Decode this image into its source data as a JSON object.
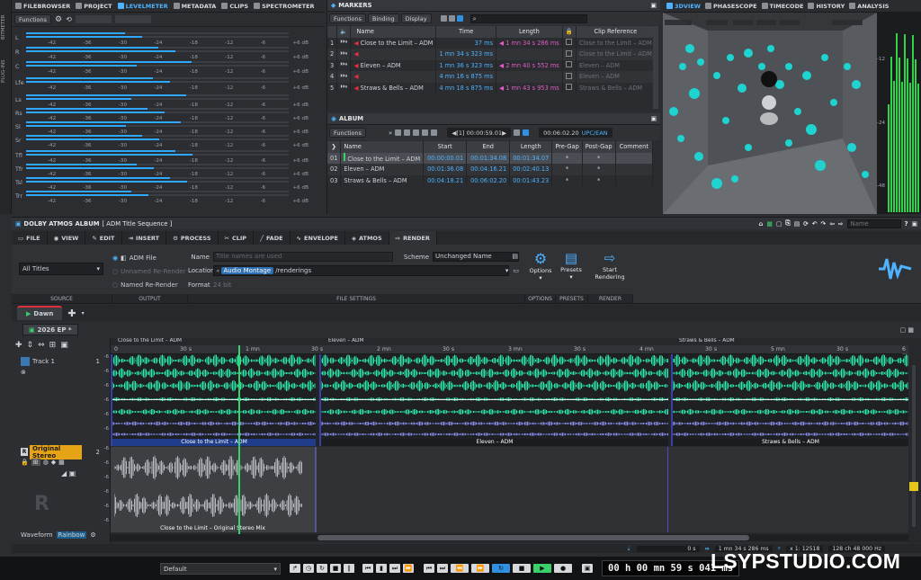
{
  "top_tabs": [
    {
      "label": "FILEBROWSER",
      "active": false
    },
    {
      "label": "PROJECT",
      "active": false
    },
    {
      "label": "LEVELMETER",
      "active": true
    },
    {
      "label": "METADATA",
      "active": false
    },
    {
      "label": "CLIPS",
      "active": false
    },
    {
      "label": "SPECTROMETER",
      "active": false
    }
  ],
  "side_strip": {
    "items": [
      "BITMETER",
      "PLUG-INS"
    ]
  },
  "levelmeter": {
    "functions_label": "Functions",
    "scale": [
      "-42",
      "-36",
      "-30",
      "-24",
      "-18",
      "-12",
      "-6",
      "+6 dB"
    ],
    "channels": [
      "L",
      "R",
      "C",
      "Lfe",
      "Ls",
      "Rs",
      "Sl",
      "Sr",
      "Tfl",
      "Tfr",
      "Tsl",
      "Trr"
    ]
  },
  "markers": {
    "title": "MARKERS",
    "toolbar": [
      "Functions",
      "Binding",
      "Display"
    ],
    "columns": [
      "Name",
      "Time",
      "Length",
      "Clip Reference"
    ],
    "rows": [
      {
        "num": "1",
        "name": "Close to the Limit – ADM",
        "time": "37 ms",
        "length": "1 mn 34 s 286 ms",
        "clip": "Close to the Limit – ADM"
      },
      {
        "num": "2",
        "name": "",
        "time": "1 mn 34 s 323 ms",
        "length": "",
        "clip": "Close to the Limit – ADM"
      },
      {
        "num": "3",
        "name": "Eleven – ADM",
        "time": "1 mn 36 s 323 ms",
        "length": "2 mn 40 s 552 ms",
        "clip": "Eleven – ADM"
      },
      {
        "num": "4",
        "name": "",
        "time": "4 mn 16 s 875 ms",
        "length": "",
        "clip": "Eleven – ADM"
      },
      {
        "num": "5",
        "name": "Straws & Bells – ADM",
        "time": "4 mn 18 s 875 ms",
        "length": "1 mn 43 s 953 ms",
        "clip": "Straws & Bells – ADM"
      }
    ]
  },
  "album": {
    "title": "ALBUM",
    "functions_label": "Functions",
    "position": "[1] 00:00:59.01",
    "total": "00:06:02.20",
    "upc_label": "UPC/EAN",
    "columns": [
      "Name",
      "Start",
      "End",
      "Length",
      "Pre-Gap",
      "Post-Gap",
      "Comment"
    ],
    "rows": [
      {
        "num": "01",
        "name": "Close to the Limit – ADM",
        "start": "00:00:00.01",
        "end": "00:01:34.08",
        "length": "00:01:34.07",
        "pre": "*",
        "post": "*"
      },
      {
        "num": "02",
        "name": "Eleven – ADM",
        "start": "00:01:36.08",
        "end": "00:04:16.21",
        "length": "00:02:40.13",
        "pre": "*",
        "post": "*"
      },
      {
        "num": "03",
        "name": "Straws & Bells – ADM",
        "start": "00:04:18.21",
        "end": "00:06:02.20",
        "length": "00:01:43.23",
        "pre": "*",
        "post": "*"
      }
    ]
  },
  "right_tabs": [
    {
      "label": "3DVIEW",
      "active": true
    },
    {
      "label": "PHASESCOPE",
      "active": false
    },
    {
      "label": "TIMECODE",
      "active": false
    },
    {
      "label": "HISTORY",
      "active": false
    },
    {
      "label": "ANALYSIS",
      "active": false
    }
  ],
  "view3d_meter": {
    "labels": [
      "-12",
      "-24",
      "-48"
    ]
  },
  "main": {
    "title": "DOLBY ATMOS ALBUM",
    "subtitle": "[ ADM Title Sequence ]",
    "name_field_placeholder": "Name",
    "ribbon_tabs": [
      {
        "label": "FILE",
        "active": false
      },
      {
        "label": "VIEW",
        "active": false
      },
      {
        "label": "EDIT",
        "active": false
      },
      {
        "label": "INSERT",
        "active": false
      },
      {
        "label": "PROCESS",
        "active": false
      },
      {
        "label": "CLIP",
        "active": false
      },
      {
        "label": "FADE",
        "active": false
      },
      {
        "label": "ENVELOPE",
        "active": false
      },
      {
        "label": "ATMOS",
        "active": false
      },
      {
        "label": "RENDER",
        "active": true
      }
    ],
    "render": {
      "source_value": "All Titles",
      "output_options": [
        "ADM File",
        "Unnamed Re-Render",
        "Named Re-Render"
      ],
      "name_label": "Name",
      "name_placeholder": "Title names are used",
      "scheme_label": "Scheme",
      "scheme_value": "Unchanged Name",
      "location_label": "Location",
      "location_chip": "Audio Montage",
      "location_path": "/renderings",
      "format_label": "Format",
      "format_value": "24 bit",
      "buttons": [
        "Options",
        "Presets",
        "Start Rendering"
      ],
      "groups": [
        "SOURCE",
        "OUTPUT",
        "FILE SETTINGS",
        "OPTIONS",
        "PRESETS",
        "RENDER"
      ]
    },
    "doc_tab": "Dawn",
    "sub_tab": "2026 EP *",
    "ruler": [
      "0",
      "30 s",
      "1 mn",
      "30 s",
      "2 mn",
      "30 s",
      "3 mn",
      "30 s",
      "4 mn",
      "30 s",
      "5 mn",
      "30 s",
      "6 mn"
    ],
    "ruler_clips": [
      "Close to the Limit – ADM",
      "Eleven – ADM",
      "Straws & Bells – ADM"
    ],
    "track1": {
      "label": "Track 1",
      "num": "1",
      "db": [
        "-6",
        "-6",
        "-6",
        "-6",
        "-6",
        "-6"
      ],
      "clips": [
        "Close to the Limit – ADM",
        "Eleven – ADM",
        "Straws & Bells – ADM"
      ]
    },
    "track2": {
      "label": "Original Stereo",
      "num": "2",
      "db": [
        "-6",
        "-6",
        "-6",
        "-6",
        "-6",
        "-6"
      ],
      "clip": "Close to the Limit – Original Stereo Mix",
      "letter": "R"
    },
    "view_tabs": [
      "Waveform",
      "Rainbow"
    ],
    "status": {
      "pos": "0 s",
      "length": "1 mn 34 s 286 ms",
      "zoom": "x 1: 12518",
      "format": "128 ch 48 000 Hz"
    }
  },
  "transport": {
    "preset": "Default",
    "time": "00 h 00 mn 59 s 041 ms"
  },
  "watermark": "LSYPSTUDIO.COM",
  "colors": {
    "accent": "#2fa7ff",
    "wave": "#2ee8a8",
    "playhead": "#3ad06c",
    "marker": "#e0303a"
  }
}
